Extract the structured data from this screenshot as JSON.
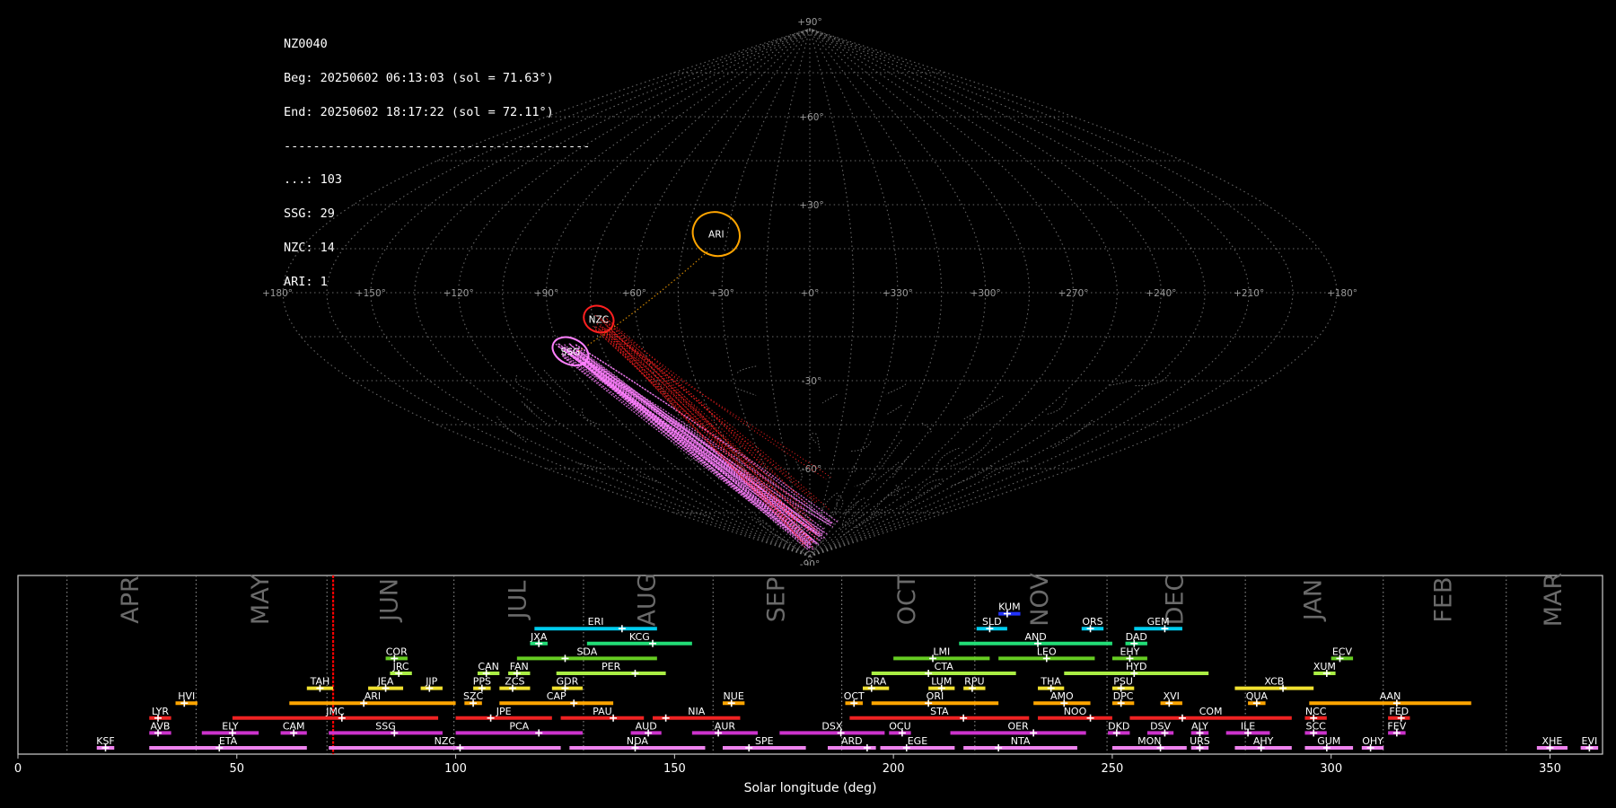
{
  "header": {
    "station": "NZ0040",
    "beg": "Beg: 20250602 06:13:03 (sol = 71.63°)",
    "end": "End: 20250602 18:17:22 (sol = 72.11°)",
    "rule": "------------------------------------------",
    "counts": [
      "...: 103",
      "SSG: 29",
      "NZC: 14",
      "ARI: 1"
    ]
  },
  "colors": {
    "background": "#000000",
    "grid": "#8a8a8a",
    "ARI": "#ffa500",
    "NZC": "#ff2020",
    "SSG": "#ff80ff",
    "cursor": "#ff0000"
  },
  "sky_map": {
    "lon_labels": [
      "+180°",
      "+150°",
      "+120°",
      "+90°",
      "+60°",
      "+30°",
      "+0°",
      "+330°",
      "+300°",
      "+270°",
      "+240°",
      "+210°",
      "+180°"
    ],
    "lat_labels": [
      "+90°",
      "+60°",
      "+30°",
      "-30°",
      "-60°",
      "-90°"
    ],
    "radiants": [
      {
        "code": "ARI",
        "lon": -34,
        "lat": 20,
        "a": 14,
        "b": 10
      },
      {
        "code": "NZC",
        "lon": -73,
        "lat": -9,
        "a": 9,
        "b": 6
      },
      {
        "code": "SSG",
        "lon": -87,
        "lat": -20,
        "a": 11,
        "b": 6
      }
    ]
  },
  "chart_data": {
    "type": "gantt",
    "xlabel": "Solar longitude (deg)",
    "xlim": [
      0,
      362
    ],
    "x_ticks": [
      0,
      50,
      100,
      150,
      200,
      250,
      300,
      350
    ],
    "current_sol": 72,
    "months": [
      {
        "name": "APR",
        "start": 11.2
      },
      {
        "name": "MAY",
        "start": 40.7
      },
      {
        "name": "JUN",
        "start": 70.6
      },
      {
        "name": "JUL",
        "start": 99.6
      },
      {
        "name": "AUG",
        "start": 129.2
      },
      {
        "name": "SEP",
        "start": 158.8
      },
      {
        "name": "OCT",
        "start": 188.2
      },
      {
        "name": "NOV",
        "start": 218.6
      },
      {
        "name": "DEC",
        "start": 248.8
      },
      {
        "name": "JAN",
        "start": 280.4
      },
      {
        "name": "FEB",
        "start": 311.9
      },
      {
        "name": "MAR",
        "start": 340.0
      }
    ],
    "showers": [
      {
        "code": "KSF",
        "start": 18,
        "end": 22,
        "peak": 20,
        "row": 0,
        "color": "#ee82ee"
      },
      {
        "code": "ETA",
        "start": 30,
        "end": 66,
        "peak": 46,
        "row": 0,
        "color": "#ee82ee"
      },
      {
        "code": "NZC",
        "start": 71,
        "end": 124,
        "peak": 101,
        "row": 0,
        "color": "#ee82ee"
      },
      {
        "code": "NDA",
        "start": 126,
        "end": 157,
        "peak": 141,
        "row": 0,
        "color": "#ee82ee"
      },
      {
        "code": "SPE",
        "start": 161,
        "end": 180,
        "peak": 167,
        "row": 0,
        "color": "#ee82ee"
      },
      {
        "code": "ARD",
        "start": 185,
        "end": 196,
        "peak": 194,
        "row": 0,
        "color": "#ee82ee"
      },
      {
        "code": "EGE",
        "start": 197,
        "end": 214,
        "peak": 203,
        "row": 0,
        "color": "#ee82ee"
      },
      {
        "code": "NTA",
        "start": 216,
        "end": 242,
        "peak": 224,
        "row": 0,
        "color": "#ee82ee"
      },
      {
        "code": "MON",
        "start": 250,
        "end": 267,
        "peak": 261,
        "row": 0,
        "color": "#ee82ee"
      },
      {
        "code": "URS",
        "start": 268,
        "end": 272,
        "peak": 270,
        "row": 0,
        "color": "#ee82ee"
      },
      {
        "code": "AHY",
        "start": 278,
        "end": 291,
        "peak": 284,
        "row": 0,
        "color": "#ee82ee"
      },
      {
        "code": "GUM",
        "start": 294,
        "end": 305,
        "peak": 299,
        "row": 0,
        "color": "#ee82ee"
      },
      {
        "code": "OHY",
        "start": 307,
        "end": 312,
        "peak": 309,
        "row": 0,
        "color": "#ee82ee"
      },
      {
        "code": "XHE",
        "start": 347,
        "end": 354,
        "peak": 350,
        "row": 0,
        "color": "#ee82ee"
      },
      {
        "code": "EVI",
        "start": 357,
        "end": 361,
        "peak": 359,
        "row": 0,
        "color": "#ee82ee"
      },
      {
        "code": "AVB",
        "start": 30,
        "end": 35,
        "peak": 32,
        "row": 1,
        "color": "#cc33cc"
      },
      {
        "code": "ELY",
        "start": 42,
        "end": 55,
        "peak": 49,
        "row": 1,
        "color": "#cc33cc"
      },
      {
        "code": "CAM",
        "start": 60,
        "end": 66,
        "peak": 63,
        "row": 1,
        "color": "#cc33cc"
      },
      {
        "code": "SSG",
        "start": 71,
        "end": 97,
        "peak": 86,
        "row": 1,
        "color": "#cc33cc"
      },
      {
        "code": "PCA",
        "start": 100,
        "end": 129,
        "peak": 119,
        "row": 1,
        "color": "#cc33cc"
      },
      {
        "code": "AUD",
        "start": 140,
        "end": 147,
        "peak": 144,
        "row": 1,
        "color": "#cc33cc"
      },
      {
        "code": "AUR",
        "start": 154,
        "end": 169,
        "peak": 160,
        "row": 1,
        "color": "#cc33cc"
      },
      {
        "code": "DSX",
        "start": 174,
        "end": 198,
        "peak": 188,
        "row": 1,
        "color": "#cc33cc"
      },
      {
        "code": "OCU",
        "start": 199,
        "end": 204,
        "peak": 202,
        "row": 1,
        "color": "#cc33cc"
      },
      {
        "code": "OER",
        "start": 213,
        "end": 244,
        "peak": 232,
        "row": 1,
        "color": "#cc33cc"
      },
      {
        "code": "DKD",
        "start": 249,
        "end": 254,
        "peak": 251,
        "row": 1,
        "color": "#cc33cc"
      },
      {
        "code": "DSV",
        "start": 258,
        "end": 264,
        "peak": 262,
        "row": 1,
        "color": "#cc33cc"
      },
      {
        "code": "ALY",
        "start": 268,
        "end": 272,
        "peak": 270,
        "row": 1,
        "color": "#cc33cc"
      },
      {
        "code": "ILE",
        "start": 276,
        "end": 286,
        "peak": 281,
        "row": 1,
        "color": "#cc33cc"
      },
      {
        "code": "SCC",
        "start": 294,
        "end": 299,
        "peak": 296,
        "row": 1,
        "color": "#cc33cc"
      },
      {
        "code": "FEV",
        "start": 313,
        "end": 317,
        "peak": 315,
        "row": 1,
        "color": "#cc33cc"
      },
      {
        "code": "LYR",
        "start": 30,
        "end": 35,
        "peak": 32,
        "row": 2,
        "color": "#ee2222"
      },
      {
        "code": "JMC",
        "start": 49,
        "end": 96,
        "peak": 74,
        "row": 2,
        "color": "#ee2222"
      },
      {
        "code": "JPE",
        "start": 100,
        "end": 122,
        "peak": 108,
        "row": 2,
        "color": "#ee2222"
      },
      {
        "code": "PAU",
        "start": 124,
        "end": 143,
        "peak": 136,
        "row": 2,
        "color": "#ee2222"
      },
      {
        "code": "NIA",
        "start": 145,
        "end": 165,
        "peak": 148,
        "row": 2,
        "color": "#ee2222"
      },
      {
        "code": "STA",
        "start": 190,
        "end": 231,
        "peak": 216,
        "row": 2,
        "color": "#ee2222"
      },
      {
        "code": "NOO",
        "start": 233,
        "end": 250,
        "peak": 245,
        "row": 2,
        "color": "#ee2222"
      },
      {
        "code": "COM",
        "start": 254,
        "end": 291,
        "peak": 266,
        "row": 2,
        "color": "#ee2222"
      },
      {
        "code": "NCC",
        "start": 294,
        "end": 299,
        "peak": 296,
        "row": 2,
        "color": "#ee2222"
      },
      {
        "code": "FED",
        "start": 313,
        "end": 318,
        "peak": 316,
        "row": 2,
        "color": "#ee2222"
      },
      {
        "code": "HVI",
        "start": 36,
        "end": 41,
        "peak": 38,
        "row": 3,
        "color": "#ffa500"
      },
      {
        "code": "ARI",
        "start": 62,
        "end": 100,
        "peak": 79,
        "row": 3,
        "color": "#ffa500"
      },
      {
        "code": "SZC",
        "start": 102,
        "end": 106,
        "peak": 104,
        "row": 3,
        "color": "#ffa500"
      },
      {
        "code": "CAP",
        "start": 110,
        "end": 136,
        "peak": 127,
        "row": 3,
        "color": "#ffa500"
      },
      {
        "code": "NUE",
        "start": 161,
        "end": 166,
        "peak": 163,
        "row": 3,
        "color": "#ffa500"
      },
      {
        "code": "OCT",
        "start": 189,
        "end": 193,
        "peak": 191,
        "row": 3,
        "color": "#ffa500"
      },
      {
        "code": "ORI",
        "start": 195,
        "end": 224,
        "peak": 208,
        "row": 3,
        "color": "#ffa500"
      },
      {
        "code": "AMO",
        "start": 232,
        "end": 245,
        "peak": 239,
        "row": 3,
        "color": "#ffa500"
      },
      {
        "code": "DPC",
        "start": 250,
        "end": 255,
        "peak": 252,
        "row": 3,
        "color": "#ffa500"
      },
      {
        "code": "XVI",
        "start": 261,
        "end": 266,
        "peak": 263,
        "row": 3,
        "color": "#ffa500"
      },
      {
        "code": "QUA",
        "start": 281,
        "end": 285,
        "peak": 283,
        "row": 3,
        "color": "#ffa500"
      },
      {
        "code": "AAN",
        "start": 295,
        "end": 332,
        "peak": 315,
        "row": 3,
        "color": "#ffa500"
      },
      {
        "code": "TAH",
        "start": 66,
        "end": 72,
        "peak": 69,
        "row": 4,
        "color": "#f0e030"
      },
      {
        "code": "JEA",
        "start": 80,
        "end": 88,
        "peak": 84,
        "row": 4,
        "color": "#f0e030"
      },
      {
        "code": "JIP",
        "start": 92,
        "end": 97,
        "peak": 94,
        "row": 4,
        "color": "#f0e030"
      },
      {
        "code": "PPS",
        "start": 104,
        "end": 108,
        "peak": 106,
        "row": 4,
        "color": "#f0e030"
      },
      {
        "code": "ZCS",
        "start": 110,
        "end": 117,
        "peak": 113,
        "row": 4,
        "color": "#f0e030"
      },
      {
        "code": "GDR",
        "start": 122,
        "end": 129,
        "peak": 125,
        "row": 4,
        "color": "#f0e030"
      },
      {
        "code": "DRA",
        "start": 193,
        "end": 199,
        "peak": 195,
        "row": 4,
        "color": "#f0e030"
      },
      {
        "code": "LUM",
        "start": 208,
        "end": 214,
        "peak": 211,
        "row": 4,
        "color": "#f0e030"
      },
      {
        "code": "RPU",
        "start": 216,
        "end": 221,
        "peak": 218,
        "row": 4,
        "color": "#f0e030"
      },
      {
        "code": "THA",
        "start": 233,
        "end": 239,
        "peak": 236,
        "row": 4,
        "color": "#f0e030"
      },
      {
        "code": "PSU",
        "start": 250,
        "end": 255,
        "peak": 252,
        "row": 4,
        "color": "#f0e030"
      },
      {
        "code": "XCB",
        "start": 278,
        "end": 296,
        "peak": 289,
        "row": 4,
        "color": "#f0e030"
      },
      {
        "code": "JRC",
        "start": 85,
        "end": 90,
        "peak": 87,
        "row": 5,
        "color": "#aaee44"
      },
      {
        "code": "CAN",
        "start": 105,
        "end": 110,
        "peak": 107,
        "row": 5,
        "color": "#aaee44"
      },
      {
        "code": "FAN",
        "start": 112,
        "end": 117,
        "peak": 114,
        "row": 5,
        "color": "#aaee44"
      },
      {
        "code": "PER",
        "start": 123,
        "end": 148,
        "peak": 141,
        "row": 5,
        "color": "#aaee44"
      },
      {
        "code": "CTA",
        "start": 195,
        "end": 228,
        "peak": 208,
        "row": 5,
        "color": "#aaee44"
      },
      {
        "code": "HYD",
        "start": 239,
        "end": 272,
        "peak": 255,
        "row": 5,
        "color": "#aaee44"
      },
      {
        "code": "XUM",
        "start": 296,
        "end": 301,
        "peak": 299,
        "row": 5,
        "color": "#aaee44"
      },
      {
        "code": "COR",
        "start": 84,
        "end": 89,
        "peak": 86,
        "row": 6,
        "color": "#66cc22"
      },
      {
        "code": "SDA",
        "start": 114,
        "end": 146,
        "peak": 125,
        "row": 6,
        "color": "#66cc22"
      },
      {
        "code": "LMI",
        "start": 200,
        "end": 222,
        "peak": 209,
        "row": 6,
        "color": "#66cc22"
      },
      {
        "code": "LEO",
        "start": 224,
        "end": 246,
        "peak": 235,
        "row": 6,
        "color": "#66cc22"
      },
      {
        "code": "EHY",
        "start": 250,
        "end": 258,
        "peak": 254,
        "row": 6,
        "color": "#66cc22"
      },
      {
        "code": "ECV",
        "start": 300,
        "end": 305,
        "peak": 302,
        "row": 6,
        "color": "#66cc22"
      },
      {
        "code": "JXA",
        "start": 117,
        "end": 121,
        "peak": 119,
        "row": 7,
        "color": "#22dd77"
      },
      {
        "code": "KCG",
        "start": 130,
        "end": 154,
        "peak": 145,
        "row": 7,
        "color": "#22dd77"
      },
      {
        "code": "AND",
        "start": 215,
        "end": 250,
        "peak": 233,
        "row": 7,
        "color": "#22dd77"
      },
      {
        "code": "DAD",
        "start": 253,
        "end": 258,
        "peak": 255,
        "row": 7,
        "color": "#22dd77"
      },
      {
        "code": "ERI",
        "start": 118,
        "end": 146,
        "peak": 138,
        "row": 8,
        "color": "#00ccee"
      },
      {
        "code": "SLD",
        "start": 219,
        "end": 226,
        "peak": 222,
        "row": 8,
        "color": "#00ccee"
      },
      {
        "code": "ORS",
        "start": 243,
        "end": 248,
        "peak": 245,
        "row": 8,
        "color": "#00ccee"
      },
      {
        "code": "GEM",
        "start": 255,
        "end": 266,
        "peak": 262,
        "row": 8,
        "color": "#00ccee"
      },
      {
        "code": "KUM",
        "start": 224,
        "end": 229,
        "peak": 226,
        "row": 9,
        "color": "#2233ff"
      }
    ]
  }
}
